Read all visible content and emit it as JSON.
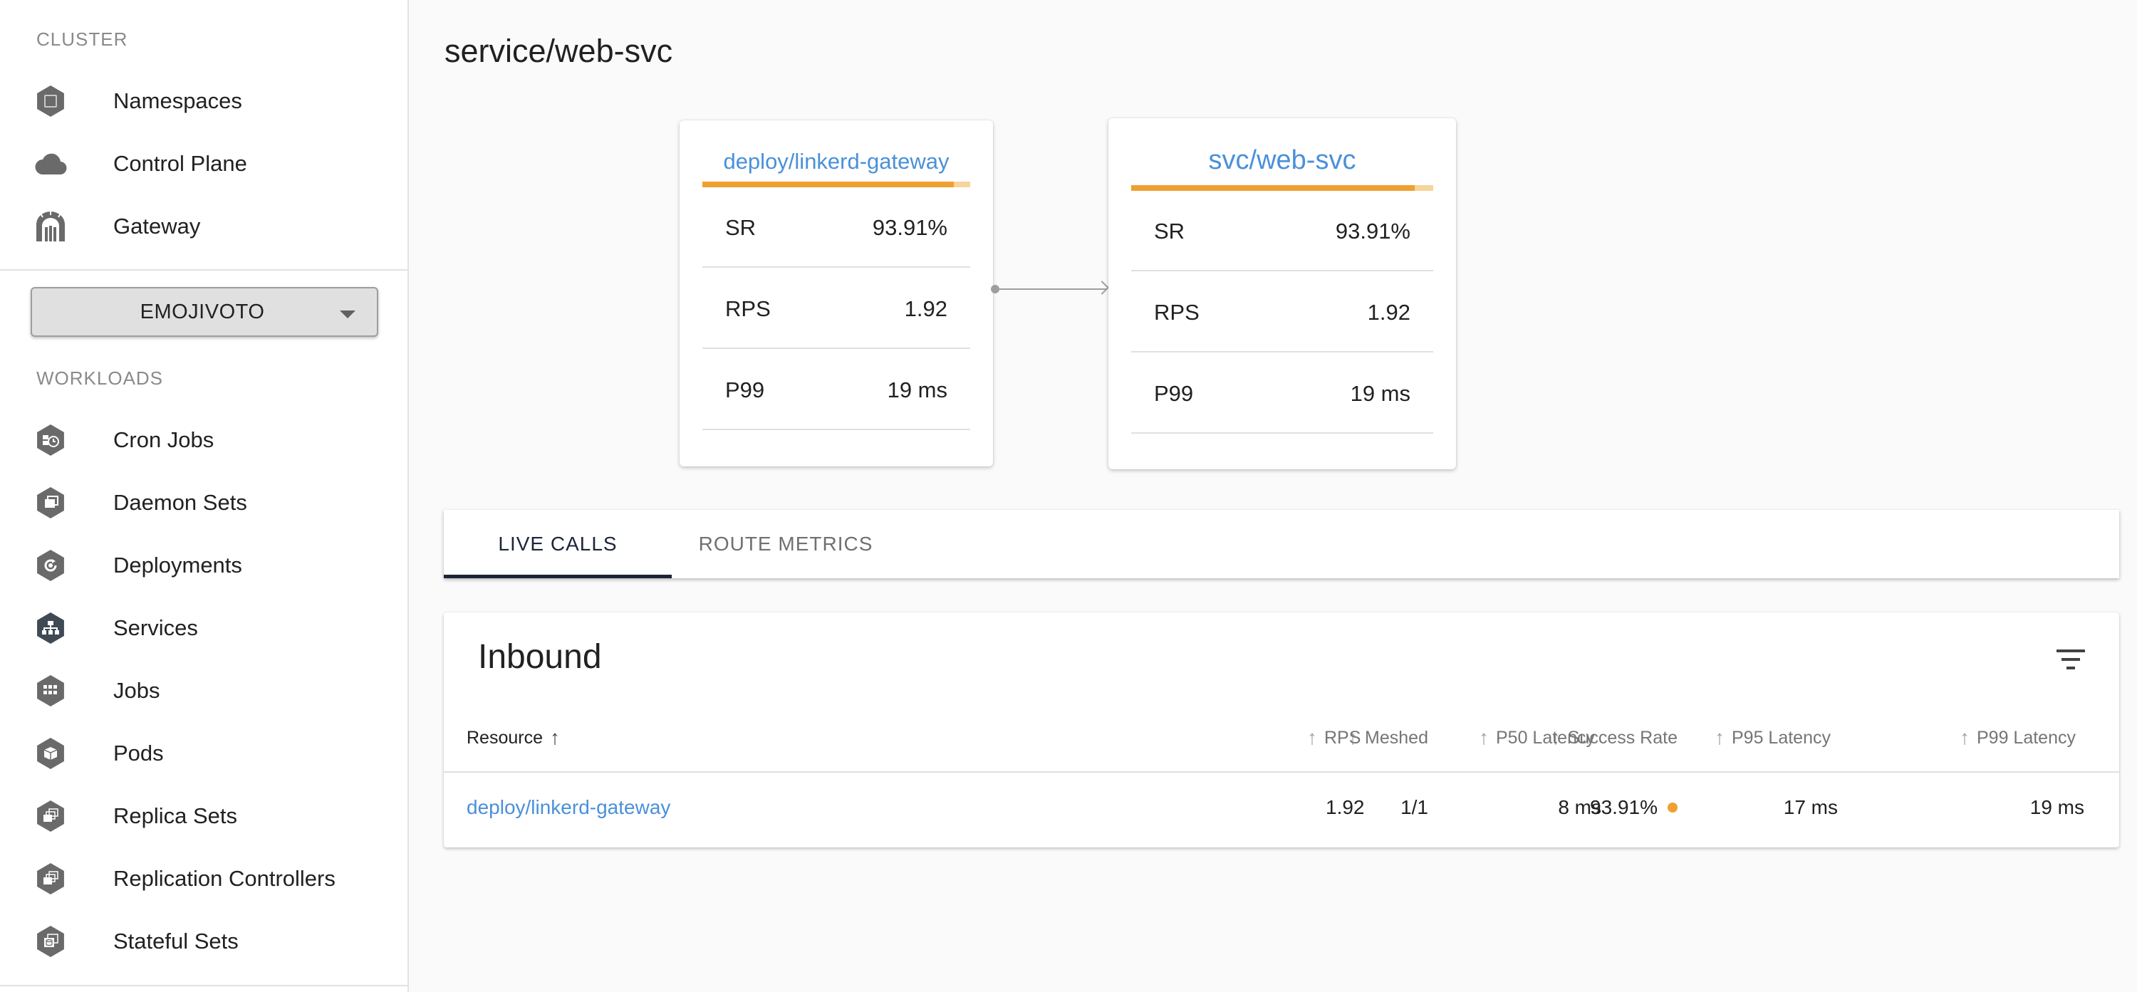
{
  "sidebar": {
    "cluster_label": "CLUSTER",
    "cluster_items": [
      {
        "label": "Namespaces",
        "icon": "namespace-icon"
      },
      {
        "label": "Control Plane",
        "icon": "cloud-icon"
      },
      {
        "label": "Gateway",
        "icon": "gateway-icon"
      }
    ],
    "namespace_select": "EMOJIVOTO",
    "workloads_label": "WORKLOADS",
    "workload_items": [
      {
        "label": "Cron Jobs",
        "icon": "cronjob-icon"
      },
      {
        "label": "Daemon Sets",
        "icon": "daemonset-icon"
      },
      {
        "label": "Deployments",
        "icon": "deployment-icon"
      },
      {
        "label": "Services",
        "icon": "service-icon"
      },
      {
        "label": "Jobs",
        "icon": "job-icon"
      },
      {
        "label": "Pods",
        "icon": "pod-icon"
      },
      {
        "label": "Replica Sets",
        "icon": "replicaset-icon"
      },
      {
        "label": "Replication Controllers",
        "icon": "replicationcontroller-icon"
      },
      {
        "label": "Stateful Sets",
        "icon": "statefulset-icon"
      }
    ]
  },
  "main": {
    "title": "service/web-svc",
    "graph": {
      "source": {
        "name": "deploy/linkerd-gateway",
        "success_fraction": 0.9391,
        "metrics": [
          {
            "name": "SR",
            "value": "93.91%"
          },
          {
            "name": "RPS",
            "value": "1.92"
          },
          {
            "name": "P99",
            "value": "19 ms"
          }
        ]
      },
      "target": {
        "name": "svc/web-svc",
        "success_fraction": 0.9391,
        "metrics": [
          {
            "name": "SR",
            "value": "93.91%"
          },
          {
            "name": "RPS",
            "value": "1.92"
          },
          {
            "name": "P99",
            "value": "19 ms"
          }
        ]
      }
    },
    "tabs": [
      {
        "label": "LIVE CALLS",
        "active": true
      },
      {
        "label": "ROUTE METRICS",
        "active": false
      }
    ],
    "inbound": {
      "title": "Inbound",
      "columns": [
        "Resource",
        "Meshed",
        "Success Rate",
        "RPS",
        "P50 Latency",
        "P95 Latency",
        "P99 Latency"
      ],
      "rows": [
        {
          "resource": "deploy/linkerd-gateway",
          "meshed": "1/1",
          "success_rate": "93.91%",
          "rps": "1.92",
          "p50": "8 ms",
          "p95": "17 ms",
          "p99": "19 ms"
        }
      ]
    }
  },
  "colors": {
    "accent_link": "#4a90d9",
    "warning": "#f0a030",
    "tab_indicator": "#1c2538"
  }
}
